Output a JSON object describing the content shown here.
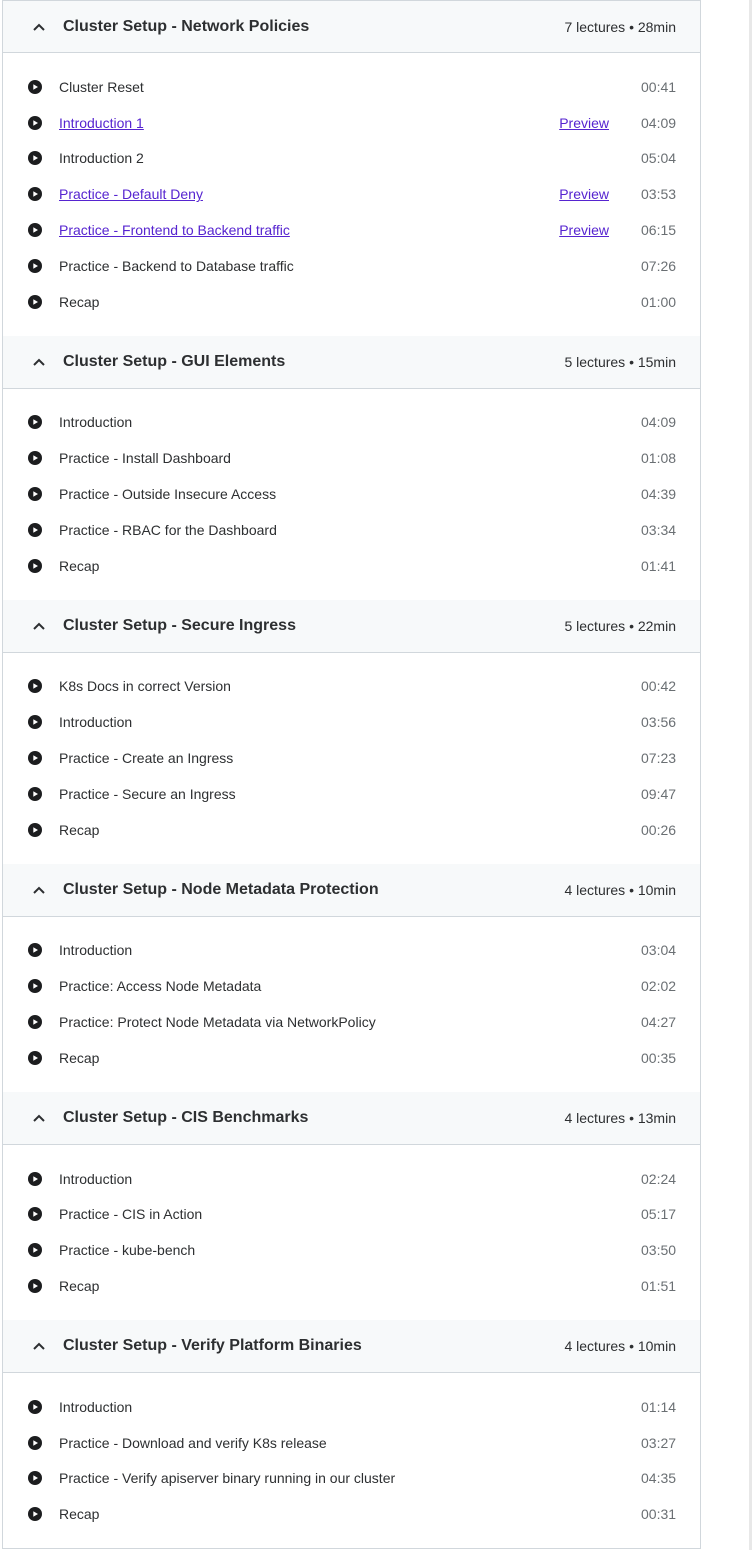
{
  "sections": [
    {
      "title": "Cluster Setup - Network Policies",
      "meta": "7 lectures • 28min",
      "lectures": [
        {
          "title": "Cluster Reset",
          "duration": "00:41",
          "preview": ""
        },
        {
          "title": "Introduction 1",
          "duration": "04:09",
          "preview": "Preview"
        },
        {
          "title": "Introduction 2",
          "duration": "05:04",
          "preview": ""
        },
        {
          "title": "Practice - Default Deny",
          "duration": "03:53",
          "preview": "Preview"
        },
        {
          "title": "Practice - Frontend to Backend traffic",
          "duration": "06:15",
          "preview": "Preview"
        },
        {
          "title": "Practice - Backend to Database traffic",
          "duration": "07:26",
          "preview": ""
        },
        {
          "title": "Recap",
          "duration": "01:00",
          "preview": ""
        }
      ]
    },
    {
      "title": "Cluster Setup - GUI Elements",
      "meta": "5 lectures • 15min",
      "lectures": [
        {
          "title": "Introduction",
          "duration": "04:09",
          "preview": ""
        },
        {
          "title": "Practice - Install Dashboard",
          "duration": "01:08",
          "preview": ""
        },
        {
          "title": "Practice - Outside Insecure Access",
          "duration": "04:39",
          "preview": ""
        },
        {
          "title": "Practice - RBAC for the Dashboard",
          "duration": "03:34",
          "preview": ""
        },
        {
          "title": "Recap",
          "duration": "01:41",
          "preview": ""
        }
      ]
    },
    {
      "title": "Cluster Setup - Secure Ingress",
      "meta": "5 lectures • 22min",
      "lectures": [
        {
          "title": "K8s Docs in correct Version",
          "duration": "00:42",
          "preview": ""
        },
        {
          "title": "Introduction",
          "duration": "03:56",
          "preview": ""
        },
        {
          "title": "Practice - Create an Ingress",
          "duration": "07:23",
          "preview": ""
        },
        {
          "title": "Practice - Secure an Ingress",
          "duration": "09:47",
          "preview": ""
        },
        {
          "title": "Recap",
          "duration": "00:26",
          "preview": ""
        }
      ]
    },
    {
      "title": "Cluster Setup - Node Metadata Protection",
      "meta": "4 lectures • 10min",
      "lectures": [
        {
          "title": "Introduction",
          "duration": "03:04",
          "preview": ""
        },
        {
          "title": "Practice: Access Node Metadata",
          "duration": "02:02",
          "preview": ""
        },
        {
          "title": "Practice: Protect Node Metadata via NetworkPolicy",
          "duration": "04:27",
          "preview": ""
        },
        {
          "title": "Recap",
          "duration": "00:35",
          "preview": ""
        }
      ]
    },
    {
      "title": "Cluster Setup - CIS Benchmarks",
      "meta": "4 lectures • 13min",
      "lectures": [
        {
          "title": "Introduction",
          "duration": "02:24",
          "preview": ""
        },
        {
          "title": "Practice - CIS in Action",
          "duration": "05:17",
          "preview": ""
        },
        {
          "title": "Practice - kube-bench",
          "duration": "03:50",
          "preview": ""
        },
        {
          "title": "Recap",
          "duration": "01:51",
          "preview": ""
        }
      ]
    },
    {
      "title": "Cluster Setup - Verify Platform Binaries",
      "meta": "4 lectures • 10min",
      "lectures": [
        {
          "title": "Introduction",
          "duration": "01:14",
          "preview": ""
        },
        {
          "title": "Practice - Download and verify K8s release",
          "duration": "03:27",
          "preview": ""
        },
        {
          "title": "Practice - Verify apiserver binary running in our cluster",
          "duration": "04:35",
          "preview": ""
        },
        {
          "title": "Recap",
          "duration": "00:31",
          "preview": ""
        }
      ]
    }
  ]
}
